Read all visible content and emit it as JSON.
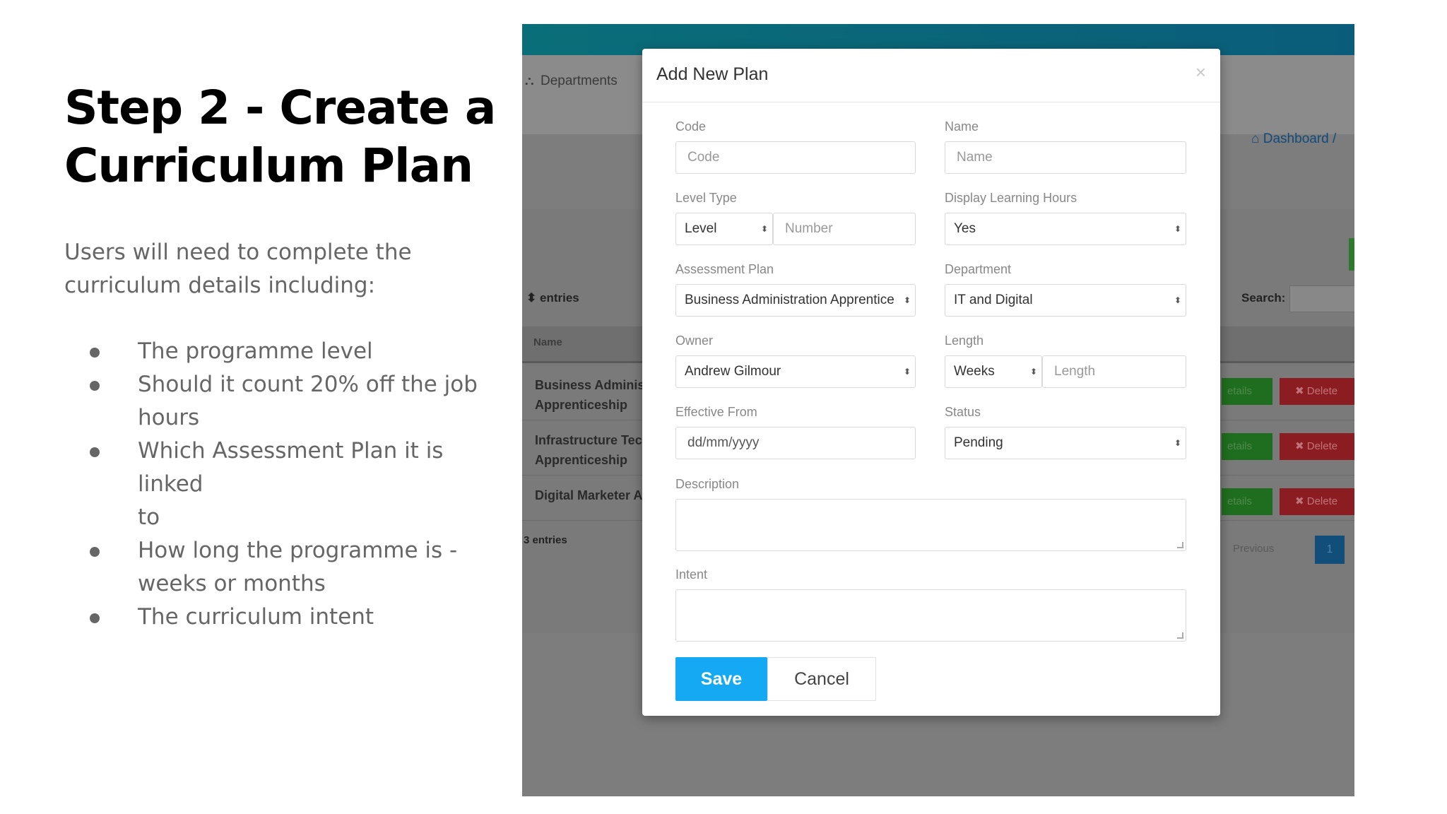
{
  "slide": {
    "title_line1": "Step 2 - Create a",
    "title_line2": "Curriculum Plan",
    "intro_line1": "Users will need to complete the",
    "intro_line2": "curriculum details including:",
    "bullets": [
      {
        "line1": "The programme level"
      },
      {
        "line1": "Should it count 20% off the job",
        "line2": "hours"
      },
      {
        "line1": "Which Assessment Plan it is linked",
        "line2": "to"
      },
      {
        "line1": "How long the programme is -",
        "line2": "weeks or months"
      },
      {
        "line1": "The curriculum intent"
      }
    ]
  },
  "background": {
    "nav_departments": "Departments",
    "breadcrumb": "Dashboard /",
    "entries_label": "entries",
    "search_label": "Search:",
    "column_name": "Name",
    "rows": [
      {
        "line1": "Business Adminis",
        "line2": "Apprenticeship"
      },
      {
        "line1": "Infrastructure Tec",
        "line2": "Apprenticeship"
      },
      {
        "line1": "Digital Marketer A"
      }
    ],
    "details_label": "etails",
    "delete_label": "✖ Delete",
    "footer_entries": "3 entries",
    "previous_label": "Previous",
    "page_number": "1"
  },
  "modal": {
    "title": "Add New Plan",
    "close_glyph": "×",
    "code": {
      "label": "Code",
      "placeholder": "Code"
    },
    "name": {
      "label": "Name",
      "placeholder": "Name"
    },
    "level_type": {
      "label": "Level Type",
      "selected": "Level",
      "number_placeholder": "Number"
    },
    "display_hours": {
      "label": "Display Learning Hours",
      "selected": "Yes"
    },
    "assessment_plan": {
      "label": "Assessment Plan",
      "selected": "Business Administration Apprentice"
    },
    "department": {
      "label": "Department",
      "selected": "IT and Digital"
    },
    "owner": {
      "label": "Owner",
      "selected": "Andrew Gilmour"
    },
    "length": {
      "label": "Length",
      "unit_selected": "Weeks",
      "placeholder": "Length"
    },
    "effective_from": {
      "label": "Effective From",
      "placeholder": "dd/mm/yyyy"
    },
    "status": {
      "label": "Status",
      "selected": "Pending"
    },
    "description": {
      "label": "Description"
    },
    "intent": {
      "label": "Intent"
    },
    "save_label": "Save",
    "cancel_label": "Cancel"
  },
  "icons": {
    "select_arrows": "⬍",
    "sitemap": "sitemap-icon",
    "home": "home-icon"
  },
  "colors": {
    "save_button": "#14a9f2",
    "topbar": "#0a6e78",
    "details_button": "#1f6e1f",
    "delete_button": "#8a1c22"
  }
}
